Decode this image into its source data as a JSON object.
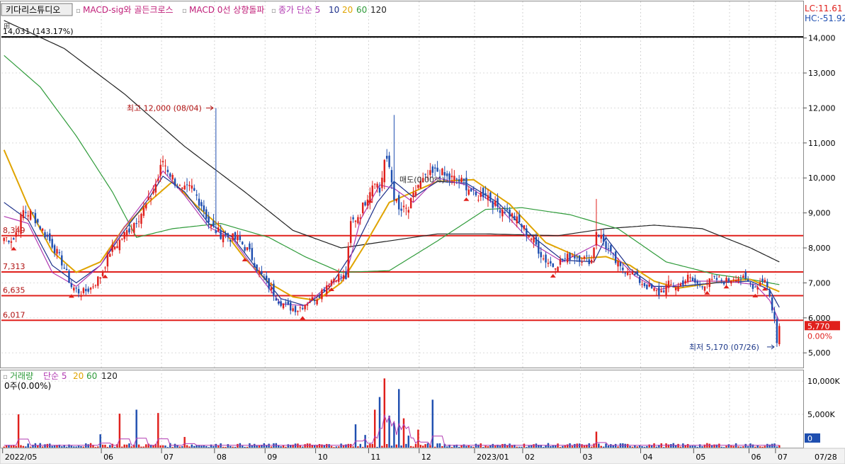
{
  "header": {
    "studio_button": "키다리스튜디오",
    "indicator_1": "MACD-sig와 골든크로스",
    "indicator_2": "MACD 0선 상향돌파",
    "ma_title": "종가 단순 5",
    "ma_periods": [
      "10",
      "20",
      "60",
      "120"
    ],
    "lc_label": "LC:11.61",
    "hc_label": "HC:-51.92"
  },
  "volume_header": {
    "title": "거래량",
    "ma_title": "단순 5",
    "ma_periods": [
      "20",
      "60",
      "120"
    ],
    "value_label": "0주(0.00%)"
  },
  "colors": {
    "up": "#e0201c",
    "down": "#1f4fb0",
    "ma5": "#b23bb2",
    "ma10": "#1c2f8a",
    "ma20": "#e0a400",
    "ma60": "#2f9b3a",
    "ma120": "#222222",
    "resistance": "#e0201c",
    "highline": "#000000"
  },
  "chart_data": [
    {
      "type": "candlestick",
      "title": "",
      "x_month_labels": [
        "2022/05",
        "06",
        "07",
        "08",
        "09",
        "10",
        "11",
        "12",
        "2023/01",
        "02",
        "03",
        "04",
        "05",
        "06",
        "07",
        "07/28"
      ],
      "y_ticks": [
        "14,000",
        "13,000",
        "12,000",
        "11,000",
        "10,000",
        "9,000",
        "8,000",
        "7,000",
        "6,000",
        "5,000"
      ],
      "ylim": [
        4600,
        14600
      ],
      "horizontal_lines": [
        {
          "label": "14,031 (143.17%)",
          "value": 14031,
          "kind": "high"
        },
        {
          "label": "8,349",
          "value": 8349,
          "kind": "support"
        },
        {
          "label": "7,313",
          "value": 7313,
          "kind": "support"
        },
        {
          "label": "6,635",
          "value": 6635,
          "kind": "support"
        },
        {
          "label": "6,017",
          "value": 5930,
          "kind": "support"
        }
      ],
      "annotations": {
        "high": "최고 12,000 (08/04)",
        "low": "최저 5,170 (07/26)",
        "mid_label": "매도(0.00%)"
      },
      "last_price_label": "5,770",
      "last_change_label": "0.00%",
      "close_anchors": [
        [
          0,
          8300
        ],
        [
          4,
          8250
        ],
        [
          8,
          9050
        ],
        [
          12,
          8950
        ],
        [
          16,
          8500
        ],
        [
          20,
          8100
        ],
        [
          24,
          7600
        ],
        [
          28,
          6900
        ],
        [
          32,
          6700
        ],
        [
          36,
          6850
        ],
        [
          40,
          7200
        ],
        [
          44,
          7900
        ],
        [
          48,
          8200
        ],
        [
          52,
          8550
        ],
        [
          56,
          8900
        ],
        [
          60,
          9300
        ],
        [
          64,
          10000
        ],
        [
          66,
          10500
        ],
        [
          70,
          10000
        ],
        [
          74,
          9600
        ],
        [
          78,
          9700
        ],
        [
          82,
          9250
        ],
        [
          86,
          8600
        ],
        [
          90,
          8400
        ],
        [
          94,
          8300
        ],
        [
          98,
          8200
        ],
        [
          102,
          7850
        ],
        [
          106,
          7300
        ],
        [
          110,
          6900
        ],
        [
          114,
          6500
        ],
        [
          118,
          6300
        ],
        [
          122,
          6250
        ],
        [
          126,
          6450
        ],
        [
          130,
          6600
        ],
        [
          134,
          6950
        ],
        [
          138,
          7200
        ],
        [
          142,
          7150
        ],
        [
          144,
          8700
        ],
        [
          148,
          9000
        ],
        [
          152,
          9700
        ],
        [
          154,
          10000
        ],
        [
          156,
          9600
        ],
        [
          158,
          10500
        ],
        [
          160,
          10300
        ],
        [
          162,
          9500
        ],
        [
          164,
          9050
        ],
        [
          168,
          9100
        ],
        [
          172,
          9800
        ],
        [
          176,
          10000
        ],
        [
          180,
          10200
        ],
        [
          184,
          10000
        ],
        [
          188,
          9950
        ],
        [
          192,
          9800
        ],
        [
          196,
          9450
        ],
        [
          200,
          9600
        ],
        [
          204,
          9200
        ],
        [
          208,
          9100
        ],
        [
          212,
          8850
        ],
        [
          216,
          8550
        ],
        [
          220,
          8200
        ],
        [
          224,
          7700
        ],
        [
          228,
          7500
        ],
        [
          232,
          7650
        ],
        [
          236,
          7800
        ],
        [
          240,
          7700
        ],
        [
          244,
          7650
        ],
        [
          246,
          8500
        ],
        [
          248,
          8300
        ],
        [
          252,
          7800
        ],
        [
          256,
          7400
        ],
        [
          260,
          7350
        ],
        [
          264,
          7050
        ],
        [
          268,
          6850
        ],
        [
          272,
          6700
        ],
        [
          276,
          6950
        ],
        [
          280,
          6900
        ],
        [
          284,
          7150
        ],
        [
          288,
          6950
        ],
        [
          292,
          7000
        ],
        [
          296,
          7100
        ],
        [
          300,
          7050
        ],
        [
          304,
          7200
        ],
        [
          308,
          7050
        ],
        [
          312,
          6900
        ],
        [
          316,
          7150
        ],
        [
          318,
          6600
        ],
        [
          320,
          5950
        ],
        [
          321,
          5250
        ],
        [
          322,
          5770
        ]
      ],
      "ma_series": [
        {
          "period": "120",
          "values": [
            [
              0,
              14500
            ],
            [
              25,
              13700
            ],
            [
              50,
              12400
            ],
            [
              75,
              10900
            ],
            [
              100,
              9600
            ],
            [
              120,
              8500
            ],
            [
              140,
              8000
            ],
            [
              160,
              8200
            ],
            [
              180,
              8400
            ],
            [
              200,
              8400
            ],
            [
              230,
              8350
            ],
            [
              250,
              8550
            ],
            [
              270,
              8650
            ],
            [
              290,
              8550
            ],
            [
              310,
              8000
            ],
            [
              322,
              7600
            ]
          ]
        },
        {
          "period": "60",
          "values": [
            [
              0,
              13500
            ],
            [
              15,
              12600
            ],
            [
              30,
              11200
            ],
            [
              45,
              9600
            ],
            [
              55,
              8300
            ],
            [
              70,
              8550
            ],
            [
              90,
              8700
            ],
            [
              110,
              8300
            ],
            [
              125,
              7750
            ],
            [
              140,
              7300
            ],
            [
              160,
              7350
            ],
            [
              180,
              8200
            ],
            [
              200,
              9100
            ],
            [
              215,
              9150
            ],
            [
              235,
              8950
            ],
            [
              255,
              8550
            ],
            [
              275,
              7600
            ],
            [
              295,
              7250
            ],
            [
              310,
              7100
            ],
            [
              322,
              6950
            ]
          ]
        },
        {
          "period": "20",
          "values": [
            [
              0,
              10800
            ],
            [
              10,
              9200
            ],
            [
              20,
              7900
            ],
            [
              30,
              7300
            ],
            [
              40,
              7600
            ],
            [
              50,
              8600
            ],
            [
              60,
              9300
            ],
            [
              70,
              9900
            ],
            [
              80,
              9200
            ],
            [
              90,
              8600
            ],
            [
              100,
              7700
            ],
            [
              110,
              7000
            ],
            [
              120,
              6600
            ],
            [
              130,
              6500
            ],
            [
              140,
              7000
            ],
            [
              150,
              8100
            ],
            [
              160,
              9300
            ],
            [
              170,
              9600
            ],
            [
              180,
              9900
            ],
            [
              195,
              9950
            ],
            [
              210,
              9250
            ],
            [
              225,
              8150
            ],
            [
              240,
              7700
            ],
            [
              250,
              7750
            ],
            [
              260,
              7500
            ],
            [
              270,
              7050
            ],
            [
              280,
              6850
            ],
            [
              290,
              6950
            ],
            [
              300,
              7050
            ],
            [
              310,
              7100
            ],
            [
              322,
              6750
            ]
          ]
        },
        {
          "period": "10",
          "values": [
            [
              0,
              9300
            ],
            [
              10,
              8800
            ],
            [
              20,
              7500
            ],
            [
              30,
              7000
            ],
            [
              40,
              7500
            ],
            [
              50,
              8500
            ],
            [
              60,
              9400
            ],
            [
              66,
              10050
            ],
            [
              75,
              9600
            ],
            [
              85,
              8700
            ],
            [
              95,
              8300
            ],
            [
              105,
              7400
            ],
            [
              115,
              6550
            ],
            [
              125,
              6350
            ],
            [
              135,
              6850
            ],
            [
              145,
              7900
            ],
            [
              155,
              9300
            ],
            [
              162,
              9900
            ],
            [
              170,
              9450
            ],
            [
              180,
              9900
            ],
            [
              192,
              9850
            ],
            [
              205,
              9300
            ],
            [
              220,
              8300
            ],
            [
              232,
              7650
            ],
            [
              245,
              7600
            ],
            [
              250,
              8300
            ],
            [
              260,
              7400
            ],
            [
              270,
              6900
            ],
            [
              280,
              6900
            ],
            [
              295,
              7000
            ],
            [
              310,
              7050
            ],
            [
              318,
              6800
            ],
            [
              322,
              6300
            ]
          ]
        },
        {
          "period": "5",
          "values": [
            [
              0,
              8900
            ],
            [
              10,
              8700
            ],
            [
              20,
              7300
            ],
            [
              30,
              6900
            ],
            [
              40,
              7500
            ],
            [
              50,
              8600
            ],
            [
              60,
              9500
            ],
            [
              66,
              10200
            ],
            [
              75,
              9500
            ],
            [
              85,
              8600
            ],
            [
              95,
              8250
            ],
            [
              105,
              7300
            ],
            [
              115,
              6400
            ],
            [
              125,
              6350
            ],
            [
              135,
              6950
            ],
            [
              142,
              7200
            ],
            [
              148,
              8800
            ],
            [
              156,
              9800
            ],
            [
              162,
              9700
            ],
            [
              170,
              9300
            ],
            [
              180,
              10000
            ],
            [
              192,
              9800
            ],
            [
              205,
              9200
            ],
            [
              220,
              8100
            ],
            [
              232,
              7600
            ],
            [
              246,
              8100
            ],
            [
              252,
              7900
            ],
            [
              262,
              7200
            ],
            [
              272,
              6800
            ],
            [
              285,
              7050
            ],
            [
              300,
              7050
            ],
            [
              312,
              6950
            ],
            [
              318,
              6500
            ],
            [
              322,
              5900
            ]
          ]
        }
      ]
    },
    {
      "type": "bar",
      "title": "거래량",
      "y_ticks": [
        "10,000K",
        "5,000K"
      ],
      "ylim": [
        0,
        11500
      ],
      "last_volume_label": "0",
      "spike_bars": [
        [
          6,
          5000
        ],
        [
          40,
          2000
        ],
        [
          48,
          5100
        ],
        [
          55,
          5700
        ],
        [
          64,
          5200
        ],
        [
          75,
          1600
        ],
        [
          146,
          3500
        ],
        [
          150,
          1900
        ],
        [
          154,
          5700
        ],
        [
          156,
          7600
        ],
        [
          158,
          10400
        ],
        [
          160,
          4800
        ],
        [
          162,
          3700
        ],
        [
          164,
          8800
        ],
        [
          166,
          4400
        ],
        [
          168,
          1800
        ],
        [
          172,
          2700
        ],
        [
          178,
          7200
        ],
        [
          246,
          2400
        ]
      ]
    }
  ]
}
